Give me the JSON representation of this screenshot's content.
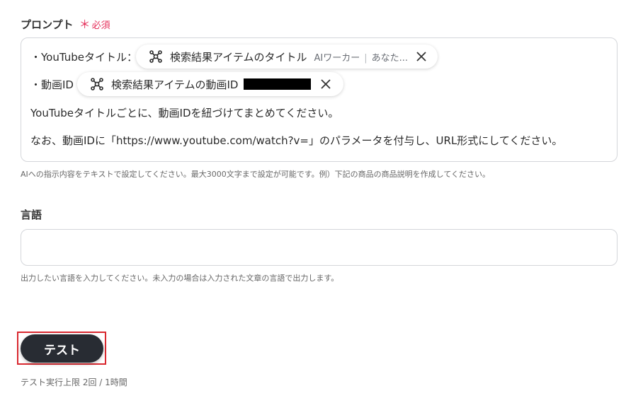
{
  "prompt": {
    "label": "プロンプト",
    "required_mark": "＊",
    "required_text": "必須",
    "line1_prefix": "・YouTubeタイトル：",
    "line2_prefix": "・動画ID",
    "line3": "YouTubeタイトルごとに、動画IDを紐づけてまとめてください。",
    "line4": "なお、動画IDに「https://www.youtube.com/watch?v=」のパラメータを付与し、URL形式にしてください。",
    "pill1": {
      "icon": "node-graph-icon",
      "text": "検索結果アイテムのタイトル",
      "source": "AIワーカー",
      "separator": "|",
      "note": "あなた..."
    },
    "pill2": {
      "icon": "node-graph-icon",
      "text": "検索結果アイテムの動画ID"
    },
    "help": "AIへの指示内容をテキストで設定してください。最大3000文字まで設定が可能です。例）下記の商品の商品説明を作成してください。"
  },
  "language": {
    "label": "言語",
    "value": "",
    "help": "出力したい言語を入力してください。未入力の場合は入力された文章の言語で出力します。"
  },
  "test": {
    "button_label": "テスト",
    "limit_text": "テスト実行上限 2回 / 1時間"
  }
}
